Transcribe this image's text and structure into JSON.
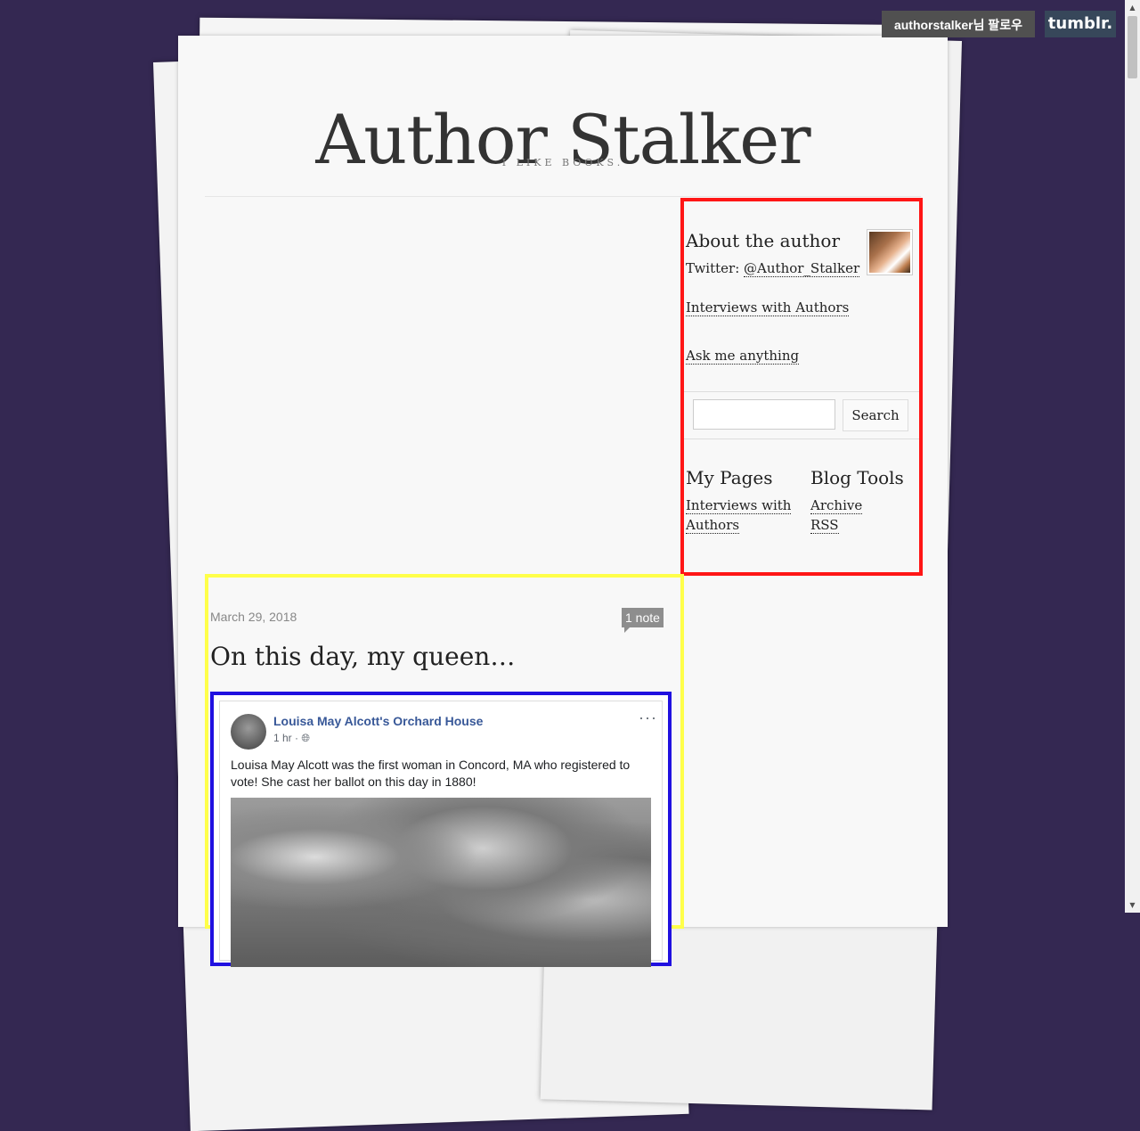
{
  "header": {
    "title": "Author Stalker",
    "description": "I like books."
  },
  "topbar": {
    "follow_label": "authorstalker님 팔로우",
    "logo": "tumblr."
  },
  "sidebar": {
    "about_title": "About the author",
    "twitter_prefix": "Twitter: ",
    "twitter_handle": "@Author_Stalker",
    "interviews_link": "Interviews with Authors",
    "ask_link": "Ask me anything",
    "search_placeholder": "",
    "search_button": "Search",
    "my_pages": {
      "title": "My Pages",
      "items": [
        "Interviews with",
        "Authors"
      ]
    },
    "blog_tools": {
      "title": "Blog Tools",
      "items": [
        "Archive",
        "RSS"
      ]
    }
  },
  "post": {
    "date": "March 29, 2018",
    "notes": "1 note",
    "title": "On this day, my queen…",
    "embed": {
      "page_name": "Louisa May Alcott's Orchard House",
      "meta": "1 hr · ",
      "more": "···",
      "text": "Louisa May Alcott was the first woman in Concord, MA who registered to vote! She cast her ballot on this day in 1880!"
    }
  },
  "colors": {
    "background": "#342852",
    "sidebar_highlight": "#ff1616",
    "post_highlight": "#ffff4a",
    "embed_highlight": "#2010e0",
    "fb_link": "#385898"
  }
}
